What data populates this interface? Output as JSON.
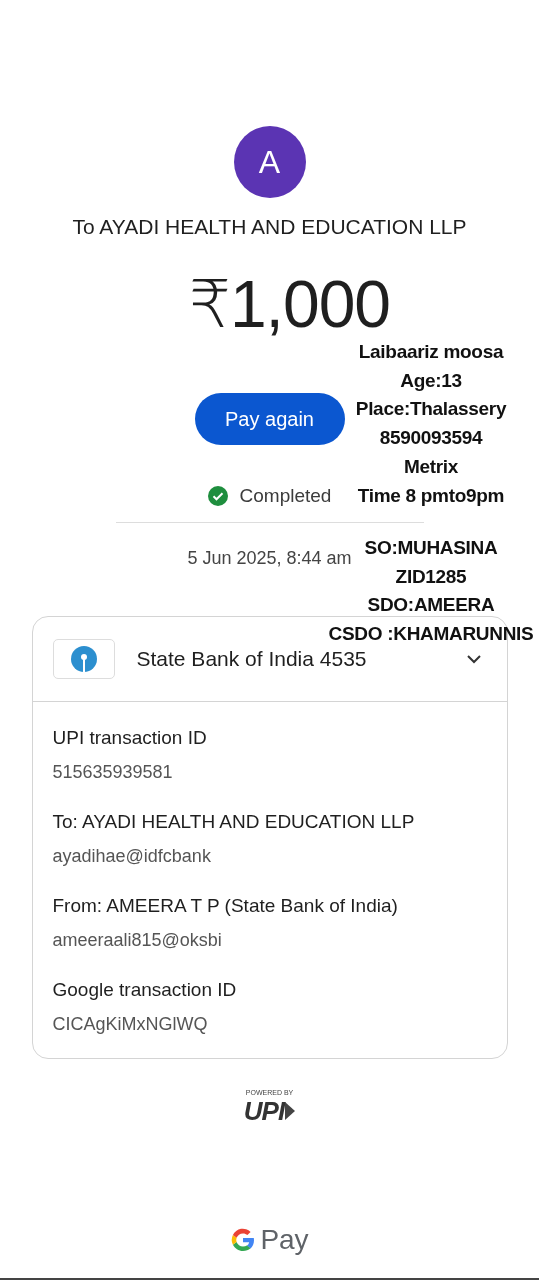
{
  "payee": {
    "initial": "A",
    "title": "To AYADI HEALTH AND EDUCATION LLP"
  },
  "amount": "₹1,000",
  "action": {
    "label": "Pay again"
  },
  "status": {
    "label": "Completed",
    "completed": true
  },
  "timestamp": "5 Jun 2025, 8:44 am",
  "account": {
    "bank": "State Bank of India 4535",
    "expanded": true
  },
  "details": [
    {
      "label": "UPI transaction ID",
      "value": "515635939581"
    },
    {
      "label": "To: AYADI HEALTH AND EDUCATION LLP",
      "value": "ayadihae@idfcbank"
    },
    {
      "label": "From: AMEERA  T P (State Bank of India)",
      "value": "ameeraali815@oksbi"
    },
    {
      "label": "Google transaction ID",
      "value": "CICAgKiMxNGlWQ"
    }
  ],
  "upi_badge": {
    "powered_by": "POWERED BY",
    "logo": "UPI"
  },
  "brand": {
    "text": "Pay"
  },
  "annotation": {
    "upper_lines": [
      "Laibaariz moosa",
      "Age:13",
      "Place:Thalassery",
      "8590093594",
      "Metrix",
      "Time 8 pmto9pm"
    ],
    "lower_lines": [
      "SO:MUHASINA",
      "ZID1285",
      "SDO:AMEERA",
      "CSDO :KHAMARUNNIS"
    ]
  }
}
